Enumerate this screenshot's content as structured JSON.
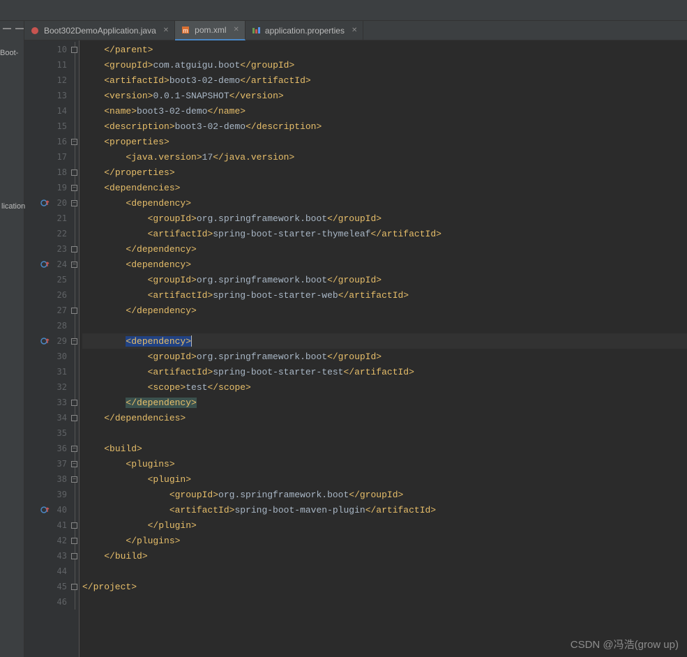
{
  "left_panel": {
    "label1": "Boot-",
    "label2": "lication"
  },
  "tabs": [
    {
      "label": "Boot302DemoApplication.java",
      "active": false,
      "icon": "java"
    },
    {
      "label": "pom.xml",
      "active": true,
      "icon": "maven"
    },
    {
      "label": "application.properties",
      "active": false,
      "icon": "props"
    }
  ],
  "watermark": "CSDN @冯浩(grow up)",
  "chart_data": null,
  "code": {
    "startLine": 10,
    "lines": [
      {
        "n": 10,
        "indent": 4,
        "fold": "end",
        "tokens": [
          {
            "t": "tag",
            "v": "</parent>"
          }
        ]
      },
      {
        "n": 11,
        "indent": 4,
        "tokens": [
          {
            "t": "tag",
            "v": "<groupId>"
          },
          {
            "t": "text",
            "v": "com.atguigu.boot"
          },
          {
            "t": "tag",
            "v": "</groupId>"
          }
        ]
      },
      {
        "n": 12,
        "indent": 4,
        "tokens": [
          {
            "t": "tag",
            "v": "<artifactId>"
          },
          {
            "t": "text",
            "v": "boot3-02-demo"
          },
          {
            "t": "tag",
            "v": "</artifactId>"
          }
        ]
      },
      {
        "n": 13,
        "indent": 4,
        "tokens": [
          {
            "t": "tag",
            "v": "<version>"
          },
          {
            "t": "text",
            "v": "0.0.1-SNAPSHOT"
          },
          {
            "t": "tag",
            "v": "</version>"
          }
        ]
      },
      {
        "n": 14,
        "indent": 4,
        "tokens": [
          {
            "t": "tag",
            "v": "<name>"
          },
          {
            "t": "text",
            "v": "boot3-02-demo"
          },
          {
            "t": "tag",
            "v": "</name>"
          }
        ]
      },
      {
        "n": 15,
        "indent": 4,
        "tokens": [
          {
            "t": "tag",
            "v": "<description>"
          },
          {
            "t": "text",
            "v": "boot3-02-demo"
          },
          {
            "t": "tag",
            "v": "</description>"
          }
        ]
      },
      {
        "n": 16,
        "indent": 4,
        "fold": "open",
        "tokens": [
          {
            "t": "tag",
            "v": "<properties>"
          }
        ]
      },
      {
        "n": 17,
        "indent": 8,
        "tokens": [
          {
            "t": "tag",
            "v": "<java.version>"
          },
          {
            "t": "text",
            "v": "17"
          },
          {
            "t": "tag",
            "v": "</java.version>"
          }
        ]
      },
      {
        "n": 18,
        "indent": 4,
        "fold": "end",
        "tokens": [
          {
            "t": "tag",
            "v": "</properties>"
          }
        ]
      },
      {
        "n": 19,
        "indent": 4,
        "fold": "open",
        "tokens": [
          {
            "t": "tag",
            "v": "<dependencies>"
          }
        ]
      },
      {
        "n": 20,
        "indent": 8,
        "fold": "open",
        "marker": "dep",
        "tokens": [
          {
            "t": "tag",
            "v": "<dependency>"
          }
        ]
      },
      {
        "n": 21,
        "indent": 12,
        "tokens": [
          {
            "t": "tag",
            "v": "<groupId>"
          },
          {
            "t": "text",
            "v": "org.springframework.boot"
          },
          {
            "t": "tag",
            "v": "</groupId>"
          }
        ]
      },
      {
        "n": 22,
        "indent": 12,
        "tokens": [
          {
            "t": "tag",
            "v": "<artifactId>"
          },
          {
            "t": "text",
            "v": "spring-boot-starter-thymeleaf"
          },
          {
            "t": "tag",
            "v": "</artifactId>"
          }
        ]
      },
      {
        "n": 23,
        "indent": 8,
        "fold": "end",
        "tokens": [
          {
            "t": "tag",
            "v": "</dependency>"
          }
        ]
      },
      {
        "n": 24,
        "indent": 8,
        "fold": "open",
        "marker": "dep",
        "tokens": [
          {
            "t": "tag",
            "v": "<dependency>"
          }
        ]
      },
      {
        "n": 25,
        "indent": 12,
        "tokens": [
          {
            "t": "tag",
            "v": "<groupId>"
          },
          {
            "t": "text",
            "v": "org.springframework.boot"
          },
          {
            "t": "tag",
            "v": "</groupId>"
          }
        ]
      },
      {
        "n": 26,
        "indent": 12,
        "tokens": [
          {
            "t": "tag",
            "v": "<artifactId>"
          },
          {
            "t": "text",
            "v": "spring-boot-starter-web"
          },
          {
            "t": "tag",
            "v": "</artifactId>"
          }
        ]
      },
      {
        "n": 27,
        "indent": 8,
        "fold": "end",
        "tokens": [
          {
            "t": "tag",
            "v": "</dependency>"
          }
        ]
      },
      {
        "n": 28,
        "indent": 0,
        "tokens": []
      },
      {
        "n": 29,
        "indent": 8,
        "fold": "open",
        "marker": "dep",
        "current": true,
        "tokens": [
          {
            "t": "tag",
            "v": "<dependency>",
            "hl": "hl"
          },
          {
            "t": "caret"
          }
        ]
      },
      {
        "n": 30,
        "indent": 12,
        "tokens": [
          {
            "t": "tag",
            "v": "<groupId>"
          },
          {
            "t": "text",
            "v": "org.springframework.boot"
          },
          {
            "t": "tag",
            "v": "</groupId>"
          }
        ]
      },
      {
        "n": 31,
        "indent": 12,
        "tokens": [
          {
            "t": "tag",
            "v": "<artifactId>"
          },
          {
            "t": "text",
            "v": "spring-boot-starter-test"
          },
          {
            "t": "tag",
            "v": "</artifactId>"
          }
        ]
      },
      {
        "n": 32,
        "indent": 12,
        "tokens": [
          {
            "t": "tag",
            "v": "<scope>"
          },
          {
            "t": "text",
            "v": "test"
          },
          {
            "t": "tag",
            "v": "</scope>"
          }
        ]
      },
      {
        "n": 33,
        "indent": 8,
        "fold": "end",
        "tokens": [
          {
            "t": "tag",
            "v": "</dependency>",
            "hl": "hl2"
          }
        ]
      },
      {
        "n": 34,
        "indent": 4,
        "fold": "end",
        "tokens": [
          {
            "t": "tag",
            "v": "</dependencies>"
          }
        ]
      },
      {
        "n": 35,
        "indent": 0,
        "tokens": []
      },
      {
        "n": 36,
        "indent": 4,
        "fold": "open",
        "tokens": [
          {
            "t": "tag",
            "v": "<build>"
          }
        ]
      },
      {
        "n": 37,
        "indent": 8,
        "fold": "open",
        "tokens": [
          {
            "t": "tag",
            "v": "<plugins>"
          }
        ]
      },
      {
        "n": 38,
        "indent": 12,
        "fold": "open",
        "tokens": [
          {
            "t": "tag",
            "v": "<plugin>"
          }
        ]
      },
      {
        "n": 39,
        "indent": 16,
        "tokens": [
          {
            "t": "tag",
            "v": "<groupId>"
          },
          {
            "t": "text",
            "v": "org.springframework.boot"
          },
          {
            "t": "tag",
            "v": "</groupId>"
          }
        ]
      },
      {
        "n": 40,
        "indent": 16,
        "marker": "dep",
        "tokens": [
          {
            "t": "tag",
            "v": "<artifactId>"
          },
          {
            "t": "text",
            "v": "spring-boot-maven-plugin"
          },
          {
            "t": "tag",
            "v": "</artifactId>"
          }
        ]
      },
      {
        "n": 41,
        "indent": 12,
        "fold": "end",
        "tokens": [
          {
            "t": "tag",
            "v": "</plugin>"
          }
        ]
      },
      {
        "n": 42,
        "indent": 8,
        "fold": "end",
        "tokens": [
          {
            "t": "tag",
            "v": "</plugins>"
          }
        ]
      },
      {
        "n": 43,
        "indent": 4,
        "fold": "end",
        "tokens": [
          {
            "t": "tag",
            "v": "</build>"
          }
        ]
      },
      {
        "n": 44,
        "indent": 0,
        "tokens": []
      },
      {
        "n": 45,
        "indent": 0,
        "fold": "end",
        "tokens": [
          {
            "t": "tag",
            "v": "</project>"
          }
        ]
      },
      {
        "n": 46,
        "indent": 0,
        "tokens": []
      }
    ]
  }
}
